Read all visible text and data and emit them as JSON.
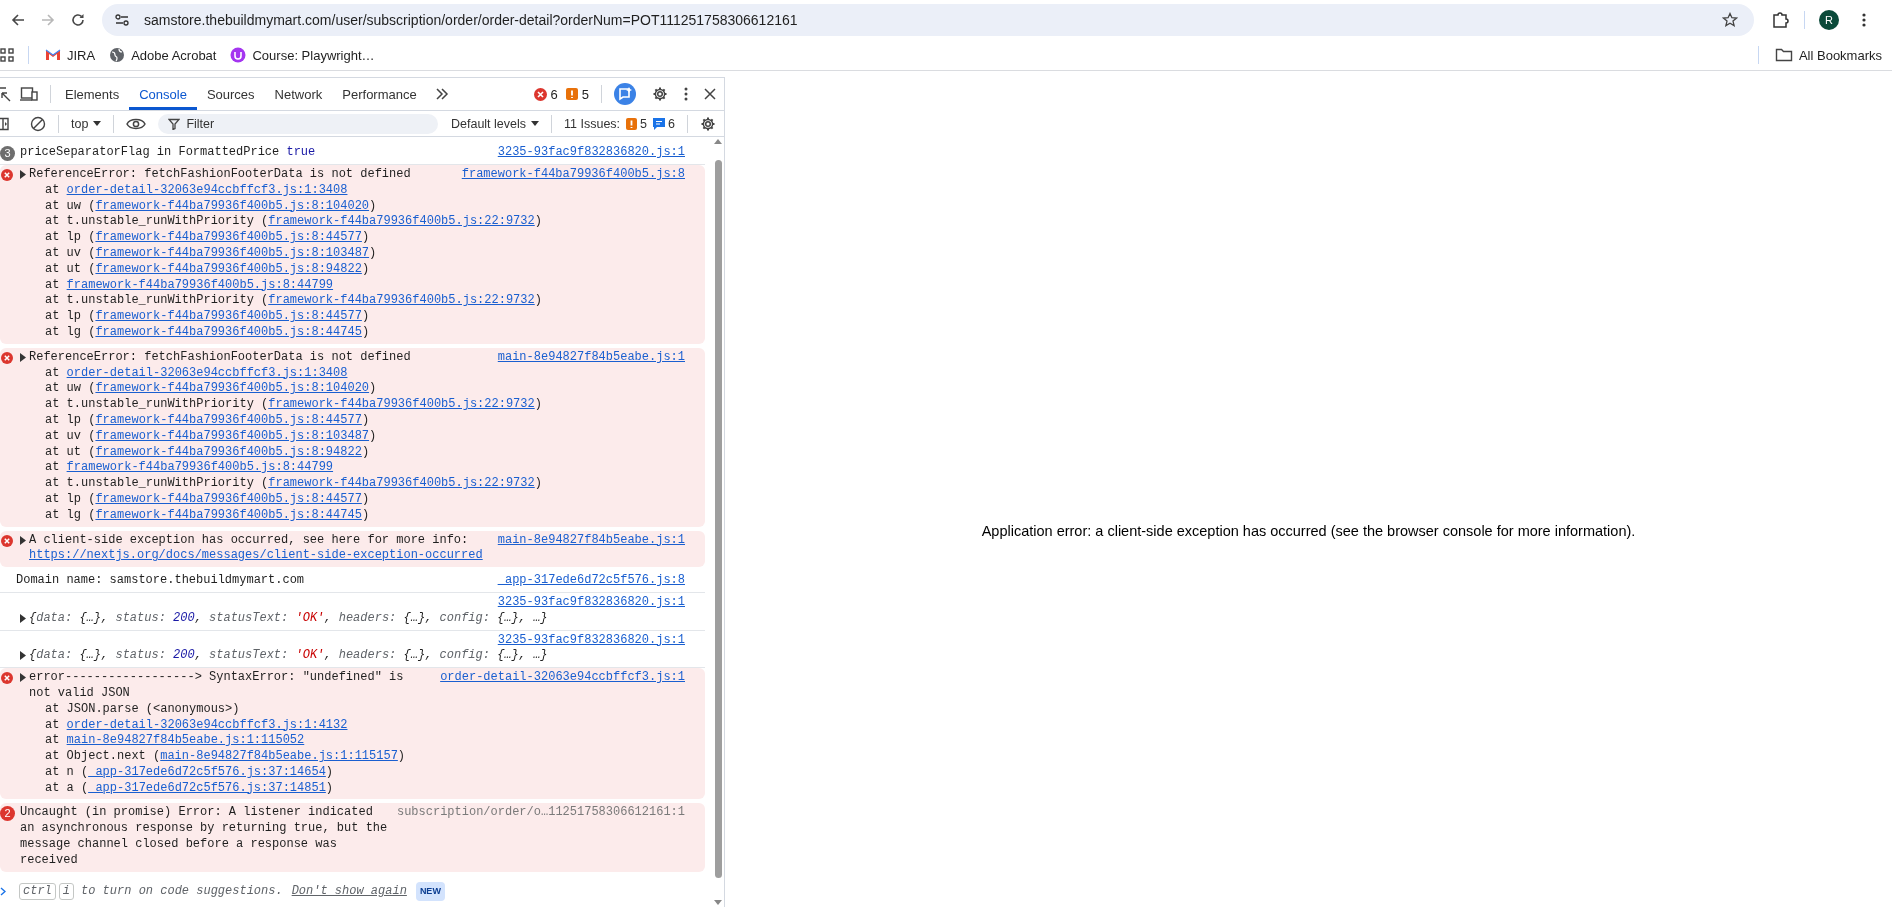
{
  "browser": {
    "url": "samstore.thebuildmymart.com/user/subscription/order/order-detail?orderNum=POT111251758306612161",
    "profile_initial": "R"
  },
  "bookmarks": [
    {
      "label": "JIRA",
      "kind": "mail"
    },
    {
      "label": "Adobe Acrobat",
      "kind": "globe"
    },
    {
      "label": "Course: Playwright…",
      "kind": "course"
    }
  ],
  "all_bookmarks": "All Bookmarks",
  "devtools": {
    "tabs": [
      {
        "label": "Elements",
        "selected": false
      },
      {
        "label": "Console",
        "selected": true
      },
      {
        "label": "Sources",
        "selected": false
      },
      {
        "label": "Network",
        "selected": false
      },
      {
        "label": "Performance",
        "selected": false
      }
    ],
    "error_count": "6",
    "warning_count": "5",
    "context": "top",
    "filter": {
      "placeholder": "Filter"
    },
    "levels": "Default levels",
    "issues": {
      "label": "11 Issues:",
      "warnings": "5",
      "infos": "6"
    }
  },
  "console": {
    "messages": [
      {
        "kind": "log",
        "count": "3",
        "expandable": false,
        "parts": [
          {
            "text": "priceSeparatorFlag in FormattedPrice ",
            "kind": "plain"
          },
          {
            "text": "true",
            "kind": "keyword"
          }
        ],
        "source": {
          "text": "3235-93fac9f832836820.js:1",
          "kind": "link"
        }
      },
      {
        "kind": "error",
        "expandable": true,
        "parts": [
          {
            "text": "ReferenceError: fetchFashionFooterData is not defined",
            "kind": "plain"
          }
        ],
        "source": {
          "text": "framework-f44ba79936f400b5.js:8",
          "kind": "link"
        },
        "frames": [
          {
            "before": "at ",
            "link": "order-detail-32063e94ccbffcf3.js:1:3408"
          },
          {
            "before": "at uw (",
            "link": "framework-f44ba79936f400b5.js:8:104020",
            "after": ")"
          },
          {
            "before": "at t.unstable_runWithPriority (",
            "link": "framework-f44ba79936f400b5.js:22:9732",
            "after": ")"
          },
          {
            "before": "at lp (",
            "link": "framework-f44ba79936f400b5.js:8:44577",
            "after": ")"
          },
          {
            "before": "at uv (",
            "link": "framework-f44ba79936f400b5.js:8:103487",
            "after": ")"
          },
          {
            "before": "at ut (",
            "link": "framework-f44ba79936f400b5.js:8:94822",
            "after": ")"
          },
          {
            "before": "at ",
            "link": "framework-f44ba79936f400b5.js:8:44799"
          },
          {
            "before": "at t.unstable_runWithPriority (",
            "link": "framework-f44ba79936f400b5.js:22:9732",
            "after": ")"
          },
          {
            "before": "at lp (",
            "link": "framework-f44ba79936f400b5.js:8:44577",
            "after": ")"
          },
          {
            "before": "at lg (",
            "link": "framework-f44ba79936f400b5.js:8:44745",
            "after": ")"
          }
        ]
      },
      {
        "kind": "error",
        "expandable": true,
        "parts": [
          {
            "text": "ReferenceError: fetchFashionFooterData is not defined",
            "kind": "plain"
          }
        ],
        "source": {
          "text": "main-8e94827f84b5eabe.js:1",
          "kind": "link"
        },
        "frames": [
          {
            "before": "at ",
            "link": "order-detail-32063e94ccbffcf3.js:1:3408"
          },
          {
            "before": "at uw (",
            "link": "framework-f44ba79936f400b5.js:8:104020",
            "after": ")"
          },
          {
            "before": "at t.unstable_runWithPriority (",
            "link": "framework-f44ba79936f400b5.js:22:9732",
            "after": ")"
          },
          {
            "before": "at lp (",
            "link": "framework-f44ba79936f400b5.js:8:44577",
            "after": ")"
          },
          {
            "before": "at uv (",
            "link": "framework-f44ba79936f400b5.js:8:103487",
            "after": ")"
          },
          {
            "before": "at ut (",
            "link": "framework-f44ba79936f400b5.js:8:94822",
            "after": ")"
          },
          {
            "before": "at ",
            "link": "framework-f44ba79936f400b5.js:8:44799"
          },
          {
            "before": "at t.unstable_runWithPriority (",
            "link": "framework-f44ba79936f400b5.js:22:9732",
            "after": ")"
          },
          {
            "before": "at lp (",
            "link": "framework-f44ba79936f400b5.js:8:44577",
            "after": ")"
          },
          {
            "before": "at lg (",
            "link": "framework-f44ba79936f400b5.js:8:44745",
            "after": ")"
          }
        ]
      },
      {
        "kind": "error",
        "expandable": true,
        "parts": [
          {
            "text": "A client-side exception has occurred, see here for more info: ",
            "kind": "plain"
          },
          {
            "text": "https://nextjs.org/docs/messages/client-side-exception-occurred",
            "kind": "link"
          }
        ],
        "source": {
          "text": "main-8e94827f84b5eabe.js:1",
          "kind": "link"
        }
      },
      {
        "kind": "log",
        "expandable": false,
        "parts": [
          {
            "text": "Domain name: samstore.thebuildmymart.com",
            "kind": "plain"
          }
        ],
        "source": {
          "text": "_app-317ede6d72c5f576.js:8",
          "kind": "link"
        }
      },
      {
        "kind": "object",
        "expandable": true,
        "parts": [
          {
            "text": "{",
            "kind": "plain"
          },
          {
            "text": "data: ",
            "kind": "key"
          },
          {
            "text": "{…}, ",
            "kind": "plain"
          },
          {
            "text": "status: ",
            "kind": "key"
          },
          {
            "text": "200",
            "kind": "number"
          },
          {
            "text": ", ",
            "kind": "plain"
          },
          {
            "text": "statusText: ",
            "kind": "key"
          },
          {
            "text": "'OK'",
            "kind": "string"
          },
          {
            "text": ", ",
            "kind": "plain"
          },
          {
            "text": "headers: ",
            "kind": "key"
          },
          {
            "text": "{…}, ",
            "kind": "plain"
          },
          {
            "text": "config: ",
            "kind": "key"
          },
          {
            "text": "{…}, …}",
            "kind": "plain"
          }
        ],
        "source": {
          "text": "3235-93fac9f832836820.js:1",
          "kind": "link"
        }
      },
      {
        "kind": "object",
        "expandable": true,
        "parts": [
          {
            "text": "{",
            "kind": "plain"
          },
          {
            "text": "data: ",
            "kind": "key"
          },
          {
            "text": "{…}, ",
            "kind": "plain"
          },
          {
            "text": "status: ",
            "kind": "key"
          },
          {
            "text": "200",
            "kind": "number"
          },
          {
            "text": ", ",
            "kind": "plain"
          },
          {
            "text": "statusText: ",
            "kind": "key"
          },
          {
            "text": "'OK'",
            "kind": "string"
          },
          {
            "text": ", ",
            "kind": "plain"
          },
          {
            "text": "headers: ",
            "kind": "key"
          },
          {
            "text": "{…}, ",
            "kind": "plain"
          },
          {
            "text": "config: ",
            "kind": "key"
          },
          {
            "text": "{…}, …}",
            "kind": "plain"
          }
        ],
        "source": {
          "text": "3235-93fac9f832836820.js:1",
          "kind": "link"
        }
      },
      {
        "kind": "error",
        "expandable": true,
        "parts": [
          {
            "text": "error------------------> SyntaxError: \"undefined\" is not valid JSON",
            "kind": "plain"
          }
        ],
        "source": {
          "text": "order-detail-32063e94ccbffcf3.js:1",
          "kind": "link"
        },
        "frames": [
          {
            "before": "at JSON.parse (<anonymous>)"
          },
          {
            "before": "at ",
            "link": "order-detail-32063e94ccbffcf3.js:1:4132"
          },
          {
            "before": "at ",
            "link": "main-8e94827f84b5eabe.js:1:115052"
          },
          {
            "before": "at Object.next (",
            "link": "main-8e94827f84b5eabe.js:1:115157",
            "after": ")"
          },
          {
            "before": "at n (",
            "link": "_app-317ede6d72c5f576.js:37:14654",
            "after": ")"
          },
          {
            "before": "at a (",
            "link": "_app-317ede6d72c5f576.js:37:14851",
            "after": ")"
          }
        ]
      },
      {
        "kind": "error",
        "count": "2",
        "expandable": false,
        "parts": [
          {
            "text": "Uncaught (in promise) Error: A listener indicated an asynchronous response by returning true, but the message channel closed before a response was received",
            "kind": "plain"
          }
        ],
        "source": {
          "text": "subscription/order/o…11251758306612161:1",
          "kind": "plain"
        }
      }
    ],
    "prompt": {
      "keys": [
        "ctrl",
        "i"
      ],
      "text": "to turn on code suggestions.",
      "link": "Don't show again",
      "badge": "NEW"
    }
  },
  "page": {
    "message": "Application error: a client-side exception has occurred (see the browser console for more information)."
  }
}
